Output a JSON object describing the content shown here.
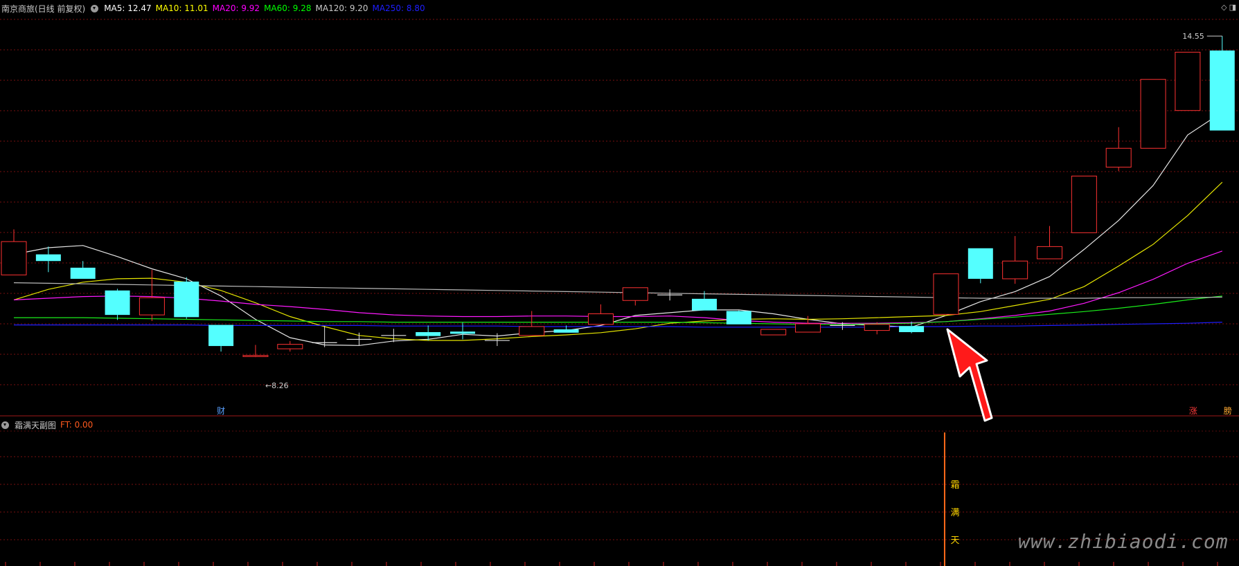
{
  "header": {
    "title": "南京商旅(日线 前复权)",
    "ma": [
      {
        "text": "MA5: 12.47",
        "color": "#ffffff"
      },
      {
        "text": "MA10: 11.01",
        "color": "#ffff00"
      },
      {
        "text": "MA20: 9.92",
        "color": "#ff00ff"
      },
      {
        "text": "MA60: 9.28",
        "color": "#00ff00"
      },
      {
        "text": "MA120: 9.20",
        "color": "#c8c8c8"
      },
      {
        "text": "MA250: 8.80",
        "color": "#1e1eff"
      }
    ]
  },
  "top_icons": [
    "◇",
    "◨"
  ],
  "sub_header": {
    "name": "霜满天副图",
    "ft": "FT: 0.00"
  },
  "colors": {
    "up": "#ff3232",
    "down": "#54ffff",
    "grid": "#7a1010",
    "signal": "#ff6a1a",
    "signal_text": "#ffd700",
    "arrow": "#ff1a1a"
  },
  "chart_data": {
    "type": "candlestick",
    "ylim": [
      7.8,
      15.0
    ],
    "candles": [
      {
        "o": 10.25,
        "c": 10.85,
        "h": 11.07,
        "l": 10.25
      },
      {
        "o": 10.62,
        "c": 10.5,
        "h": 10.76,
        "l": 10.3
      },
      {
        "o": 10.38,
        "c": 10.18,
        "h": 10.5,
        "l": 10.18
      },
      {
        "o": 9.97,
        "c": 9.53,
        "h": 10.0,
        "l": 9.44
      },
      {
        "o": 9.53,
        "c": 9.84,
        "h": 10.34,
        "l": 9.42
      },
      {
        "o": 10.13,
        "c": 9.49,
        "h": 10.21,
        "l": 9.46
      },
      {
        "o": 9.35,
        "c": 8.97,
        "h": 9.35,
        "l": 8.87
      },
      {
        "o": 8.78,
        "c": 8.8,
        "h": 8.99,
        "l": 8.77
      },
      {
        "o": 8.92,
        "c": 9.0,
        "h": 9.06,
        "l": 8.87
      },
      {
        "o": 9.03,
        "c": 9.03,
        "h": 9.33,
        "l": 8.95
      },
      {
        "o": 9.09,
        "c": 9.09,
        "h": 9.21,
        "l": 8.98
      },
      {
        "o": 9.16,
        "c": 9.16,
        "h": 9.28,
        "l": 9.04
      },
      {
        "o": 9.22,
        "c": 9.15,
        "h": 9.34,
        "l": 9.07
      },
      {
        "o": 9.23,
        "c": 9.19,
        "h": 9.39,
        "l": 9.09
      },
      {
        "o": 9.07,
        "c": 9.07,
        "h": 9.2,
        "l": 8.97
      },
      {
        "o": 9.16,
        "c": 9.32,
        "h": 9.6,
        "l": 9.16
      },
      {
        "o": 9.27,
        "c": 9.21,
        "h": 9.34,
        "l": 9.21
      },
      {
        "o": 9.36,
        "c": 9.55,
        "h": 9.72,
        "l": 9.36
      },
      {
        "o": 9.79,
        "c": 10.02,
        "h": 10.02,
        "l": 9.7
      },
      {
        "o": 9.89,
        "c": 9.89,
        "h": 9.99,
        "l": 9.79
      },
      {
        "o": 9.82,
        "c": 9.61,
        "h": 9.96,
        "l": 9.61
      },
      {
        "o": 9.6,
        "c": 9.36,
        "h": 9.61,
        "l": 9.36
      },
      {
        "o": 9.17,
        "c": 9.27,
        "h": 9.27,
        "l": 9.17
      },
      {
        "o": 9.22,
        "c": 9.37,
        "h": 9.51,
        "l": 9.22
      },
      {
        "o": 9.34,
        "c": 9.34,
        "h": 9.4,
        "l": 9.26
      },
      {
        "o": 9.25,
        "c": 9.36,
        "h": 9.4,
        "l": 9.18
      },
      {
        "o": 9.33,
        "c": 9.22,
        "h": 9.41,
        "l": 9.2
      },
      {
        "o": 9.54,
        "c": 10.27,
        "h": 10.27,
        "l": 9.54
      },
      {
        "o": 10.73,
        "c": 10.18,
        "h": 10.73,
        "l": 10.1
      },
      {
        "o": 10.18,
        "c": 10.5,
        "h": 10.95,
        "l": 10.09
      },
      {
        "o": 10.54,
        "c": 10.76,
        "h": 11.13,
        "l": 10.54
      },
      {
        "o": 11.01,
        "c": 12.03,
        "h": 12.03,
        "l": 11.01
      },
      {
        "o": 12.19,
        "c": 12.53,
        "h": 12.91,
        "l": 12.12
      },
      {
        "o": 12.53,
        "c": 13.77,
        "h": 13.77,
        "l": 12.53
      },
      {
        "o": 13.21,
        "c": 14.26,
        "h": 14.26,
        "l": 13.21
      },
      {
        "o": 14.29,
        "c": 12.85,
        "h": 14.55,
        "l": 12.85
      }
    ],
    "ma": [
      {
        "name": "MA5",
        "color": "#e6e6e6",
        "start": 0,
        "values": [
          10.62,
          10.74,
          10.78,
          10.58,
          10.36,
          10.18,
          9.87,
          9.45,
          9.12,
          8.99,
          8.98,
          9.06,
          9.09,
          9.18,
          9.15,
          9.21,
          9.25,
          9.34,
          9.52,
          9.57,
          9.62,
          9.62,
          9.55,
          9.45,
          9.37,
          9.34,
          9.31,
          9.52,
          9.77,
          9.95,
          10.22,
          10.71,
          11.23,
          11.86,
          12.77,
          13.18
        ]
      },
      {
        "name": "MA10",
        "color": "#e6e600",
        "start": 0,
        "values": [
          9.8,
          9.99,
          10.12,
          10.18,
          10.19,
          10.12,
          9.97,
          9.75,
          9.5,
          9.32,
          9.16,
          9.1,
          9.07,
          9.07,
          9.1,
          9.14,
          9.17,
          9.21,
          9.28,
          9.38,
          9.42,
          9.45,
          9.46,
          9.45,
          9.46,
          9.48,
          9.5,
          9.52,
          9.59,
          9.7,
          9.81,
          10.04,
          10.41,
          10.8,
          11.32,
          11.92
        ]
      },
      {
        "name": "MA20",
        "color": "#ff1aff",
        "start": 0,
        "values": [
          9.8,
          9.83,
          9.86,
          9.87,
          9.86,
          9.83,
          9.78,
          9.72,
          9.68,
          9.63,
          9.57,
          9.53,
          9.51,
          9.5,
          9.5,
          9.51,
          9.51,
          9.5,
          9.5,
          9.51,
          9.48,
          9.43,
          9.4,
          9.38,
          9.38,
          9.38,
          9.39,
          9.41,
          9.46,
          9.52,
          9.6,
          9.74,
          9.93,
          10.17,
          10.46,
          10.68
        ]
      },
      {
        "name": "MA60",
        "color": "#1aee1a",
        "start": 0,
        "values": [
          9.48,
          9.48,
          9.48,
          9.47,
          9.46,
          9.45,
          9.44,
          9.43,
          9.42,
          9.41,
          9.41,
          9.4,
          9.4,
          9.4,
          9.4,
          9.4,
          9.4,
          9.4,
          9.4,
          9.4,
          9.39,
          9.38,
          9.37,
          9.36,
          9.36,
          9.37,
          9.38,
          9.41,
          9.45,
          9.49,
          9.54,
          9.59,
          9.65,
          9.72,
          9.8,
          9.87
        ]
      },
      {
        "name": "MA120",
        "color": "#bbbbbb",
        "start": 0,
        "values": [
          10.11,
          10.1,
          10.09,
          10.08,
          10.07,
          10.06,
          10.05,
          10.04,
          10.03,
          10.02,
          10.01,
          10.0,
          9.99,
          9.98,
          9.97,
          9.96,
          9.95,
          9.94,
          9.93,
          9.92,
          9.91,
          9.9,
          9.89,
          9.88,
          9.87,
          9.86,
          9.85,
          9.84,
          9.83,
          9.83,
          9.83,
          9.83,
          9.84,
          9.84,
          9.84,
          9.85
        ]
      },
      {
        "name": "MA250",
        "color": "#1e1eff",
        "start": 0,
        "values": [
          9.35,
          9.35,
          9.35,
          9.35,
          9.35,
          9.35,
          9.34,
          9.34,
          9.34,
          9.34,
          9.34,
          9.33,
          9.33,
          9.33,
          9.33,
          9.32,
          9.32,
          9.32,
          9.32,
          9.32,
          9.31,
          9.31,
          9.31,
          9.31,
          9.31,
          9.31,
          9.32,
          9.32,
          9.33,
          9.33,
          9.34,
          9.35,
          9.36,
          9.37,
          9.38,
          9.4
        ]
      }
    ],
    "annotations": {
      "high": {
        "text": "14.55",
        "index": 35
      },
      "low": {
        "text": "8.26",
        "index": 7
      },
      "fin_marker": {
        "text": "财",
        "index": 6
      },
      "tag_zhang": {
        "text": "涨",
        "index": 34
      },
      "tag_last": {
        "text": "膀",
        "index": 35
      }
    },
    "signal": {
      "index": 27,
      "chars": [
        "霜",
        "满",
        "天"
      ]
    }
  },
  "watermark": "www.zhibiaodi.com"
}
